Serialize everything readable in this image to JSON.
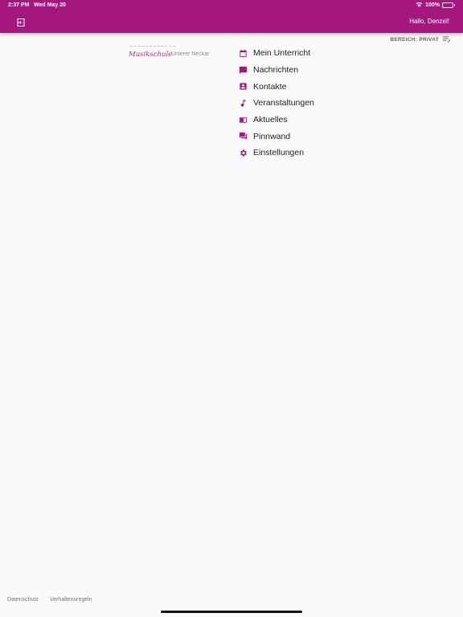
{
  "status_bar": {
    "time": "2:37 PM",
    "date": "Wed May 20",
    "battery": "100%"
  },
  "header": {
    "greeting": "Hallo, Denzel!",
    "logout_icon": "logout-icon",
    "background_color": "#a4177f"
  },
  "bereich": {
    "label": "BEREICH: PRIVAT",
    "icon": "filter-list-icon"
  },
  "logo": {
    "main": "Musikschule",
    "sub": "Unterer Neckar"
  },
  "menu": {
    "accent_color": "#a4177f",
    "items": [
      {
        "label": "Mein Unterricht",
        "icon": "calendar-icon"
      },
      {
        "label": "Nachrichten",
        "icon": "message-icon"
      },
      {
        "label": "Kontakte",
        "icon": "contact-icon"
      },
      {
        "label": "Veranstaltungen",
        "icon": "music-note-icon"
      },
      {
        "label": "Aktuelles",
        "icon": "book-icon"
      },
      {
        "label": "Pinnwand",
        "icon": "forum-icon"
      },
      {
        "label": "Einstellungen",
        "icon": "gear-icon"
      }
    ]
  },
  "footer": {
    "datenschutz": "Datenschutz",
    "verhaltensregeln": "Verhaltensregeln"
  }
}
